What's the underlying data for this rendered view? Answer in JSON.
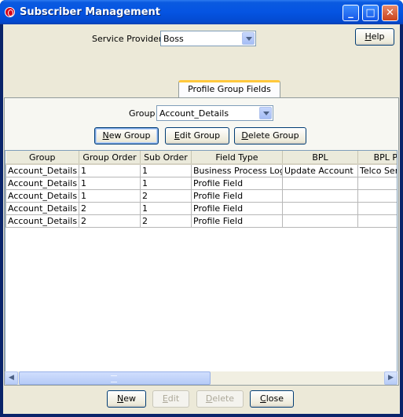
{
  "window": {
    "title": "Subscriber Management"
  },
  "titlebar_buttons": {
    "minimize": "_",
    "maximize": "□",
    "close": "✕"
  },
  "service_provider": {
    "label": "Service Provider",
    "value": "Boss"
  },
  "help_button": {
    "pre": "",
    "accel": "H",
    "post": "elp"
  },
  "tab": {
    "label": "Profile Group Fields"
  },
  "group": {
    "label": "Group",
    "value": "Account_Details"
  },
  "group_buttons": {
    "new": {
      "pre": "",
      "accel": "N",
      "post": "ew Group"
    },
    "edit": {
      "pre": "",
      "accel": "E",
      "post": "dit Group"
    },
    "delete": {
      "pre": "",
      "accel": "D",
      "post": "elete Group"
    }
  },
  "table": {
    "columns": [
      "Group",
      "Group Order",
      "Sub Order",
      "Field Type",
      "BPL",
      "BPL Perm"
    ],
    "rows": [
      [
        "Account_Details",
        "1",
        "1",
        "Business Process Logic",
        "Update Account",
        "Telco Serv"
      ],
      [
        "Account_Details",
        "1",
        "1",
        "Profile Field",
        "",
        ""
      ],
      [
        "Account_Details",
        "1",
        "2",
        "Profile Field",
        "",
        ""
      ],
      [
        "Account_Details",
        "2",
        "1",
        "Profile Field",
        "",
        ""
      ],
      [
        "Account_Details",
        "2",
        "2",
        "Profile Field",
        "",
        ""
      ]
    ]
  },
  "scrollbar": {
    "left_arrow": "◀",
    "right_arrow": "▶"
  },
  "bottom_buttons": {
    "new": {
      "pre": "",
      "accel": "N",
      "post": "ew"
    },
    "edit": {
      "pre": "",
      "accel": "E",
      "post": "dit"
    },
    "delete": {
      "pre": "",
      "accel": "D",
      "post": "elete"
    },
    "close": {
      "pre": "",
      "accel": "C",
      "post": "lose"
    }
  }
}
